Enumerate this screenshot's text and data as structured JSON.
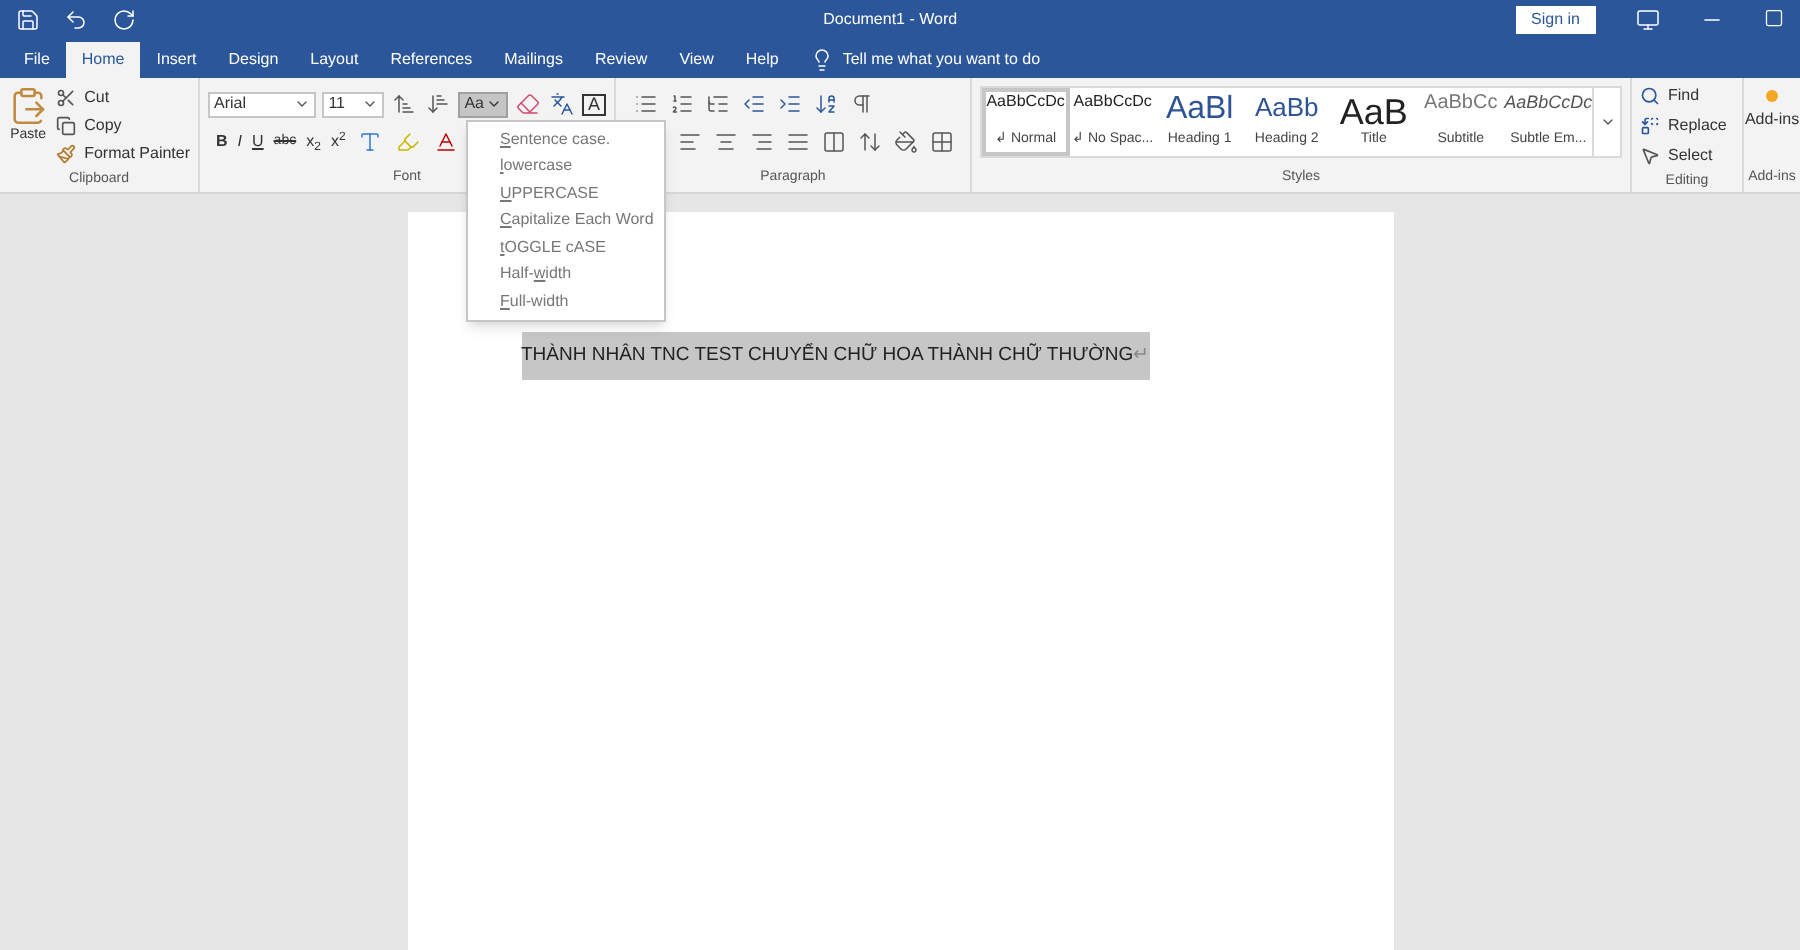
{
  "window": {
    "title": "Document1  -  Word",
    "sign_in": "Sign in"
  },
  "tabs": [
    {
      "label": "File",
      "selected": false
    },
    {
      "label": "Home",
      "selected": true
    },
    {
      "label": "Insert",
      "selected": false
    },
    {
      "label": "Design",
      "selected": false
    },
    {
      "label": "Layout",
      "selected": false
    },
    {
      "label": "References",
      "selected": false
    },
    {
      "label": "Mailings",
      "selected": false
    },
    {
      "label": "Review",
      "selected": false
    },
    {
      "label": "View",
      "selected": false
    },
    {
      "label": "Help",
      "selected": false
    }
  ],
  "tell_me": "Tell me what you want to do",
  "clipboard": {
    "paste": "Paste",
    "cut": "Cut",
    "copy": "Copy",
    "format_painter": "Format Painter",
    "group": "Clipboard"
  },
  "font": {
    "name": "Arial",
    "size": "11",
    "change_case": "Aa",
    "change_case_open": true,
    "bold": "B",
    "italic": "I",
    "underline": "U",
    "strike": "abc",
    "subscript": "x$_{2}$",
    "superscript": "x$^{2}$",
    "border_letter": "A",
    "group": "Font"
  },
  "case_menu": [
    {
      "key": "S",
      "after": "entence case."
    },
    {
      "key": "l",
      "after": "owercase"
    },
    {
      "key": "U",
      "after": "PPERCASE"
    },
    {
      "key": "C",
      "after": "apitalize Each Word"
    },
    {
      "key": "t",
      "after": "OGGLE cASE"
    },
    {
      "before": "Half-",
      "key": "w",
      "after": "idth"
    },
    {
      "key": "F",
      "after": "ull-width"
    }
  ],
  "paragraph": {
    "group": "Paragraph"
  },
  "styles": {
    "group": "Styles",
    "items": [
      {
        "preview": "AaBbCcDc",
        "name": "↲ Normal",
        "kind": "normal",
        "selected": true
      },
      {
        "preview": "AaBbCcDc",
        "name": "↲ No Spac...",
        "kind": "normal",
        "selected": false
      },
      {
        "preview": "AaBl",
        "name": "Heading 1",
        "kind": "heading1",
        "selected": false
      },
      {
        "preview": "AaBb",
        "name": "Heading 2",
        "kind": "heading2",
        "selected": false
      },
      {
        "preview": "AaB",
        "name": "Title",
        "kind": "title",
        "selected": false
      },
      {
        "preview": "AaBbCc",
        "name": "Subtitle",
        "kind": "subtitle",
        "selected": false
      },
      {
        "preview": "AaBbCcDc",
        "name": "Subtle Em...",
        "kind": "emphasis",
        "selected": false
      }
    ]
  },
  "editing": {
    "find": "Find",
    "replace": "Replace",
    "select": "Select",
    "group": "Editing"
  },
  "addins": {
    "label": "Add-ins",
    "group": "Add-ins"
  },
  "document": {
    "text": "THÀNH NHÂN TNC TEST CHUYỂN CHỮ HOA THÀNH CHỮ THƯỜNG",
    "selected": true,
    "mark": "↵"
  }
}
